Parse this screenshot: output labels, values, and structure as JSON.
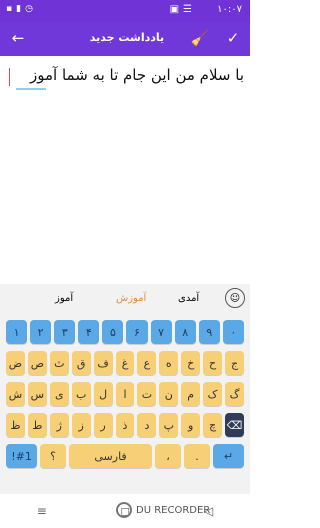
{
  "status": {
    "time": "۱۰:۰۷",
    "left_icons": [
      "sim-icon",
      "signal-icon",
      "clock-icon"
    ],
    "right_icons": [
      "gallery-icon",
      "notification-icon"
    ]
  },
  "toolbar": {
    "title": "یادداشت جدید"
  },
  "editor": {
    "text": "با سلام من این جام تا به شما آموز"
  },
  "keyboard": {
    "suggestions": [
      "آموز",
      "آموزش",
      "آمدی"
    ],
    "numbers": [
      "۱",
      "۲",
      "۳",
      "۴",
      "۵",
      "۶",
      "۷",
      "۸",
      "۹",
      "۰"
    ],
    "row2": [
      "ض",
      "ص",
      "ث",
      "ق",
      "ف",
      "غ",
      "ع",
      "ه",
      "خ",
      "ح",
      "ج"
    ],
    "row3": [
      "ش",
      "س",
      "ی",
      "ب",
      "ل",
      "ا",
      "ت",
      "ن",
      "م",
      "ک",
      "گ"
    ],
    "row4": [
      "ظ",
      "ط",
      "ژ",
      "ز",
      "ر",
      "ذ",
      "د",
      "پ",
      "و",
      "چ",
      "⌫"
    ],
    "row5": [
      "!#1",
      "؟",
      "فارسی",
      "،",
      ".",
      "↵"
    ]
  },
  "recorder": {
    "label": "DU RECORDER"
  }
}
